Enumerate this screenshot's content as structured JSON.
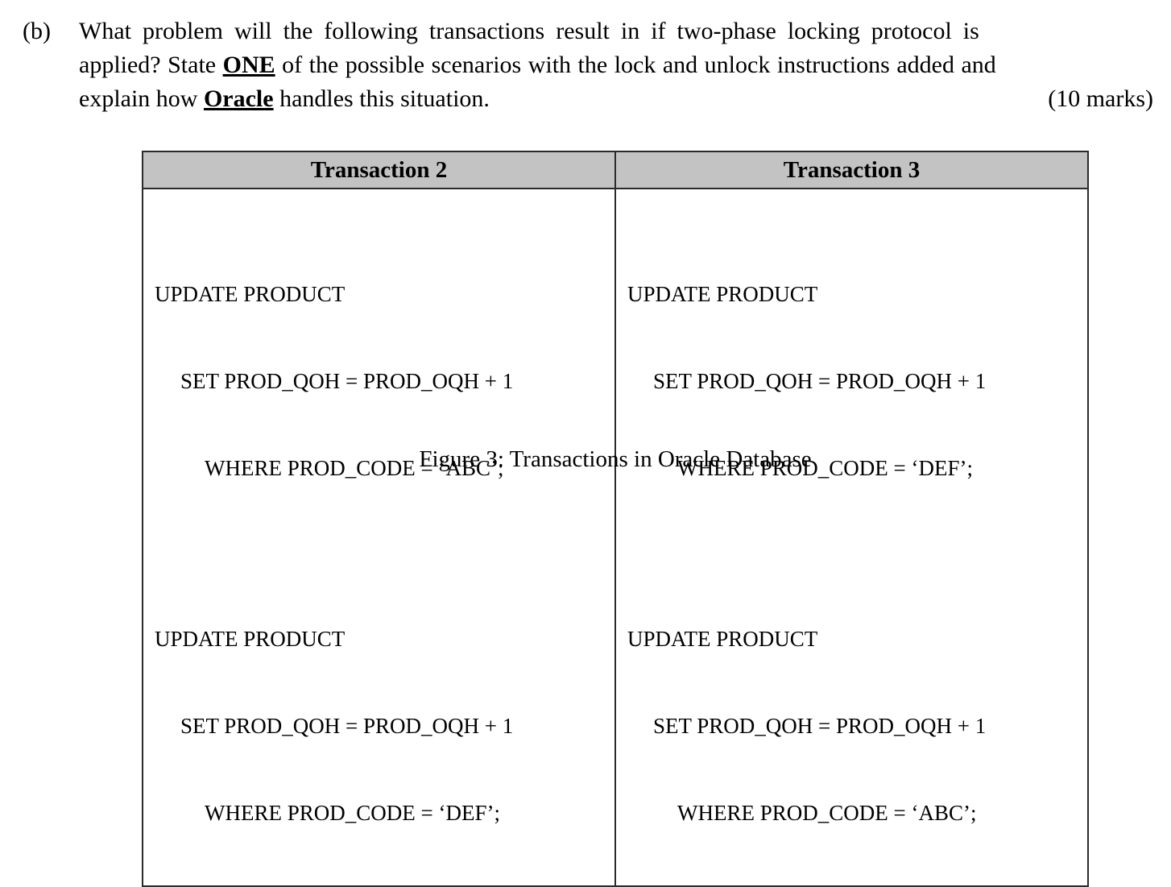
{
  "question": {
    "label": "(b)",
    "line1_a": "What problem will the following transactions result in if two-phase locking protocol is",
    "line2_a": "applied? State ",
    "line2_emph": "ONE",
    "line2_b": " of the possible scenarios with the lock and unlock instructions added and",
    "line3_a": "explain how ",
    "line3_emph": "Oracle",
    "line3_b": " handles this situation.",
    "marks": "(10 marks)"
  },
  "table": {
    "headers": [
      "Transaction 2",
      "Transaction 3"
    ],
    "columns": [
      {
        "statements": [
          [
            "UPDATE PRODUCT",
            "SET PROD_QOH = PROD_OQH + 1",
            "WHERE PROD_CODE = ‘ABC’;"
          ],
          [
            "UPDATE PRODUCT",
            "SET PROD_QOH = PROD_OQH + 1",
            "WHERE PROD_CODE = ‘DEF’;"
          ]
        ]
      },
      {
        "statements": [
          [
            "UPDATE PRODUCT",
            "SET PROD_QOH = PROD_OQH + 1",
            "WHERE PROD_CODE = ‘DEF’;"
          ],
          [
            "UPDATE PRODUCT",
            "SET PROD_QOH = PROD_OQH + 1",
            "WHERE PROD_CODE = ‘ABC’;"
          ]
        ]
      }
    ]
  },
  "caption": "Figure 3: Transactions in Oracle Database",
  "colors": {
    "page_background": "#ffffff",
    "text": "#000000",
    "table_border": "#2b2b2b",
    "header_fill": "#c3c3c3"
  }
}
